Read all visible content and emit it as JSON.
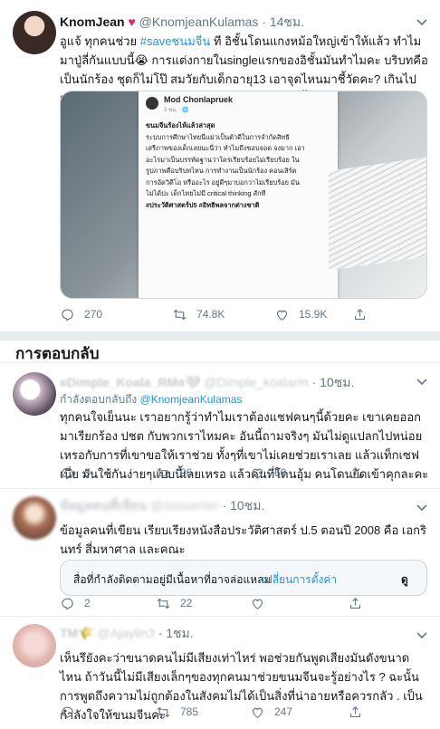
{
  "main_tweet": {
    "name": "KnomJean",
    "heart": "♥",
    "handle": "@KnomjeanKulamas",
    "time": "· 14ชม.",
    "text_pre": "อูแจ้ ทุกคนช่วย ",
    "hashtag": "#saveชนมจีน",
    "text_post": " ที อิชั้นโดนแกงหม้อใหญ่เข้าให้แล้ว ทำไมมาปู่ลี่กันแบบนี้😭 การแต่งกายในsingleแรกของอิชั้นมันทำไมคะ บริบทคือเป็นนักร้อง ชุดก็ไม่โป๊ สมวัยกับเด็กอายุ13 เอาจุดไหนมาชี้วัดคะ? เกินไปมากๆ จำกัดความคิดระบบการศึกษาแนะคะแบบนี้",
    "image": {
      "author": "Mod Chonlapruek",
      "meta": "3 ชม. · 🌐",
      "lines": [
        "ขนมจีนร้องไห้แล้วล่าสุด",
        "ระบบการศึกษาไทยนี่แม่วเป็นตัวดีในการจำกัดสิทธิ",
        "เสรีภาพของเด็กเลยนะนี่ว่า ทำไมถึงชอบจอด จงมาก เอา",
        "อะไรมาเป็นบรรทัดฐานว่าใครเรียบร้อยไม่เรียบร้อย ใน",
        "รูปภาพคือบริบทไหน การทำงานเป็นนักร้อง คอนเสิร์ต",
        "การอัดวิดีโอ หรืออะไร อยู่ดีๆมาบอกว่าไม่เรียบร้อย มัน",
        "ไม่ได้ปะ เด็กไทยไม่มี critical thinking สักที",
        "#ประวัติศาสตร์ป5 #อิทธิพลจากต่างชาติ"
      ]
    },
    "replies": "270",
    "retweets": "74.8K",
    "likes": "15.9K"
  },
  "section_title": "การตอบกลับ",
  "replies": [
    {
      "name": "ʚDimple_Koala_RMɞ🤍",
      "handle": "@Dimple_koalarm",
      "time": "· 10ชม.",
      "replying_to_label": "กำลังตอบกลับถึง ",
      "replying_to_handle": "@KnomjeanKulamas",
      "text": "ทุกคนใจเย็นนะ เราอยากรู้ว่าทำไมเราต้องแชฟคนๆนี้ด้วยคะ เขาเคยออกมาเรียกร้อง ปชต กับพวกเราไหมคะ อันนี้ถามจริงๆ มันไม่ดูแปลกไปหน่อยเหรอกับการที่เขาขอให้เราช่วย ทั้งๆที่เขาไม่เคยช่วยเราเลย แล้วแท็กเซฟเนี่ย มันใช้กันง่ายๆแบบนี้เลยเหรอ แล้วคนที่โดนอุ้ม คนโดนยัดเข้าคุกละคะ",
      "replies": "8",
      "retweets": "96",
      "likes": "60"
    },
    {
      "name": "ข้อมูลคนที่เขียน",
      "handle": "@datawriter",
      "time": "· 10ชม.",
      "text": "ข้อมูลคนที่เขียน เรียบเรียงหนังสือประวัติศาสตร์ ป.5 ตอนปี 2008 คือ เอกรินทร์ สี่มหาศาล และคณะ",
      "notice_text": "สื่อที่กำลังติดตามอยู่มีเนื้อหาที่อาจล่อแหลม",
      "notice_link": "เปลี่ยนการตั้งค่า",
      "notice_action": "ดู",
      "replies": "2",
      "retweets": "22",
      "likes": ""
    },
    {
      "name": "TM🌾",
      "handle": "@Ajaylin3",
      "time": "· 1ชม.",
      "text": "เห็นรึยังคะว่าขนาดคนไม่มีเสียงเท่าไหร่ พอช่วยกันพูดเสียงมันดังขนาดไหน ถ้าวันนี้ไม่มีเสียงเล็กๆของทุกคนมาช่วยขนมจีนจะรู้อย่างไร ? ฉะนั้นการพูดถึงความไม่ถูกต้องในสังคมไม่ได้เป็นสิ่งที่น่าอายหรือควรกลัว . เป็นกำลังใจให้ขนมจีนคะ",
      "replies": "",
      "retweets": "785",
      "likes": "247"
    }
  ],
  "colors": {
    "accent": "#1b95e0",
    "muted": "#657786",
    "heart": "#e0245e",
    "divider": "#e6ecf0"
  },
  "icons": [
    "reply-icon",
    "retweet-icon",
    "like-icon",
    "share-icon",
    "chevron-down-icon"
  ]
}
